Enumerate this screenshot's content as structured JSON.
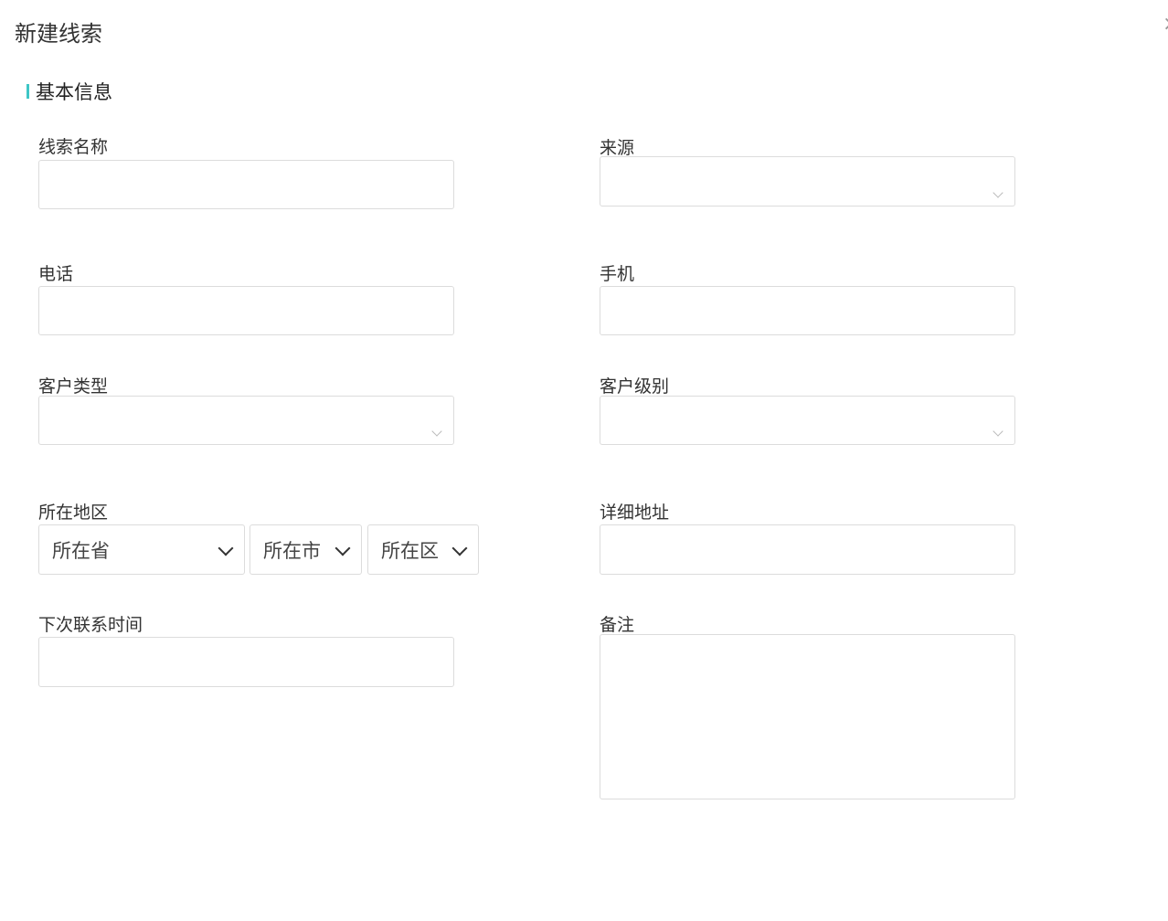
{
  "dialog": {
    "title": "新建线索",
    "close_label": "×"
  },
  "section": {
    "title": "基本信息"
  },
  "fields": {
    "name": {
      "label": "线索名称",
      "value": ""
    },
    "source": {
      "label": "来源",
      "value": ""
    },
    "phone": {
      "label": "电话",
      "value": ""
    },
    "mobile": {
      "label": "手机",
      "value": ""
    },
    "customer_type": {
      "label": "客户类型",
      "value": ""
    },
    "customer_level": {
      "label": "客户级别",
      "value": ""
    },
    "region": {
      "label": "所在地区",
      "province": "所在省",
      "city": "所在市",
      "district": "所在区"
    },
    "address": {
      "label": "详细地址",
      "value": ""
    },
    "next_contact": {
      "label": "下次联系时间",
      "value": ""
    },
    "remark": {
      "label": "备注",
      "value": ""
    }
  }
}
